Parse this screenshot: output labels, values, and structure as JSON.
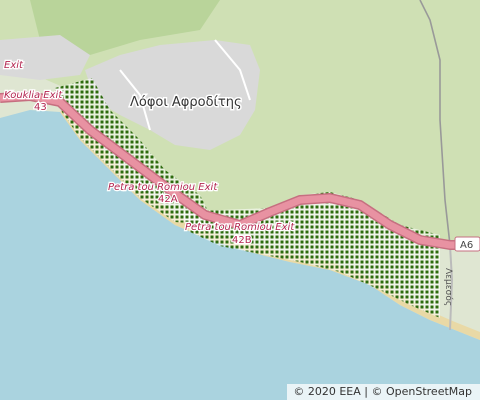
{
  "map": {
    "place_label": "Λόφοι Αφροδίτης",
    "road_labels": {
      "kouklia_exit": "Kouklia Exit",
      "kouklia_exit_number": "43",
      "petra_exit_1": "Petra tou Romiou Exit",
      "petra_exit_1_number": "42A",
      "petra_exit_2": "Petra tou Romiou Exit",
      "petra_exit_2_number": "42B",
      "top_left_exit": "Exit"
    },
    "highway_shield": "A6",
    "side_road": "Λεμεσός",
    "colors": {
      "sea": "#aad3df",
      "land": "#dfe6d2",
      "forest": "#c9dcaa",
      "motorway": "#e892a2",
      "protected_area": "#2d6b0e",
      "urban": "#d9d9d9"
    }
  },
  "attribution": {
    "eea": "© 2020 EEA",
    "separator": "|",
    "osm": "© OpenStreetMap"
  }
}
